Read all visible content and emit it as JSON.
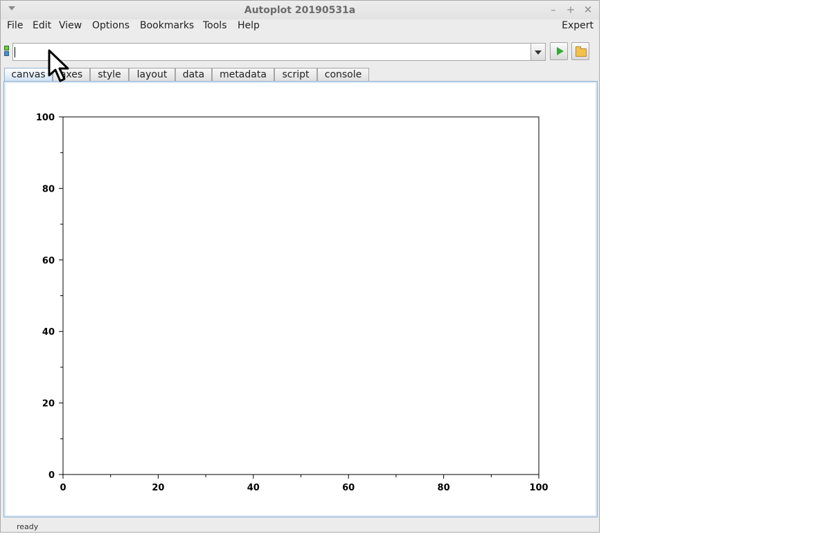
{
  "window": {
    "title": "Autoplot 20190531a"
  },
  "menubar": {
    "items": [
      "File",
      "Edit",
      "View",
      "Options",
      "Bookmarks",
      "Tools",
      "Help"
    ],
    "right": "Expert"
  },
  "uribar": {
    "value": "",
    "placeholder": ""
  },
  "tabs": [
    {
      "label": "canvas",
      "active": true
    },
    {
      "label": "axes",
      "active": false
    },
    {
      "label": "style",
      "active": false
    },
    {
      "label": "layout",
      "active": false
    },
    {
      "label": "data",
      "active": false
    },
    {
      "label": "metadata",
      "active": false
    },
    {
      "label": "script",
      "active": false
    },
    {
      "label": "console",
      "active": false
    }
  ],
  "status": {
    "text": "ready"
  },
  "icons": {
    "title_menu": "dropdown-triangle-icon",
    "minimize": "minimize-icon",
    "maximize": "maximize-icon",
    "close": "close-icon",
    "go": "play-icon",
    "browse": "folder-icon",
    "pointer": "mouse-pointer-icon"
  },
  "chart_data": {
    "type": "scatter",
    "x": [],
    "y": [],
    "xlim": [
      0,
      100
    ],
    "ylim": [
      0,
      100
    ],
    "x_ticks": [
      "0",
      "20",
      "40",
      "60",
      "80",
      "100"
    ],
    "y_ticks": [
      "0",
      "20",
      "40",
      "60",
      "80",
      "100"
    ],
    "grid": false
  }
}
